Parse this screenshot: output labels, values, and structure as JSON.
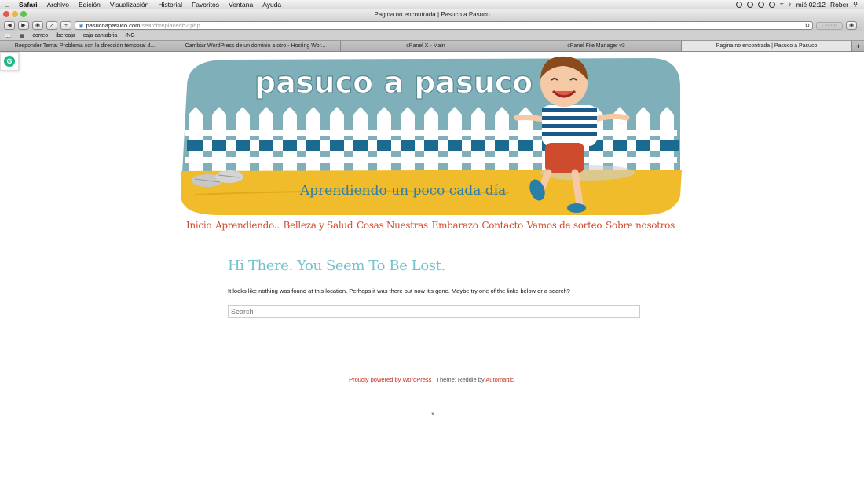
{
  "menubar": {
    "app": "Safari",
    "items": [
      "Archivo",
      "Edición",
      "Visualización",
      "Historial",
      "Favoritos",
      "Ventana",
      "Ayuda"
    ],
    "clock": "mié 02:12",
    "user": "Rober"
  },
  "window": {
    "title": "Pagina no encontrada | Pasuco a Pasuco"
  },
  "toolbar": {
    "url_domain": "pasucoapasuco.com",
    "url_path": "/searchreplacedb2.php",
    "reader_label": "Lector"
  },
  "bookmarks": [
    "correo",
    "ibercaja",
    "caja cantabria",
    "ING"
  ],
  "tabs": [
    {
      "label": "Responder Tema: Problema con la dirección temporal d..."
    },
    {
      "label": "Cambiar WordPress de un dominio a otro - Hosting Wor..."
    },
    {
      "label": "cPanel X - Main"
    },
    {
      "label": "cPanel File Manager v3"
    },
    {
      "label": "Pagina no encontrada | Pasuco a Pasuco"
    }
  ],
  "header": {
    "site_title": "pasuco a pasuco",
    "tagline": "Aprendiendo un poco cada día"
  },
  "nav": [
    {
      "label": "Inicio"
    },
    {
      "label": "Aprendiendo.."
    },
    {
      "label": "Belleza y Salud"
    },
    {
      "label": "Cosas Nuestras"
    },
    {
      "label": "Embarazo"
    },
    {
      "label": "Contacto"
    },
    {
      "label": "Vamos de sorteo"
    },
    {
      "label": "Sobre nosotros"
    }
  ],
  "main": {
    "heading": "Hi There. You Seem To Be Lost.",
    "message": "It looks like nothing was found at this location. Perhaps it was there but now it's gone. Maybe try one of the links below or a search?",
    "search_placeholder": "Search"
  },
  "footer": {
    "powered": "Proudly powered by WordPress",
    "sep": "|",
    "theme": "Theme: Reddle by",
    "author": "Automattic."
  },
  "colors": {
    "sky": "#7fb0ba",
    "ground": "#f0bc2c",
    "fence_blue": "#1a6b8f",
    "nav": "#d34a2c",
    "heading": "#74c2ce"
  }
}
